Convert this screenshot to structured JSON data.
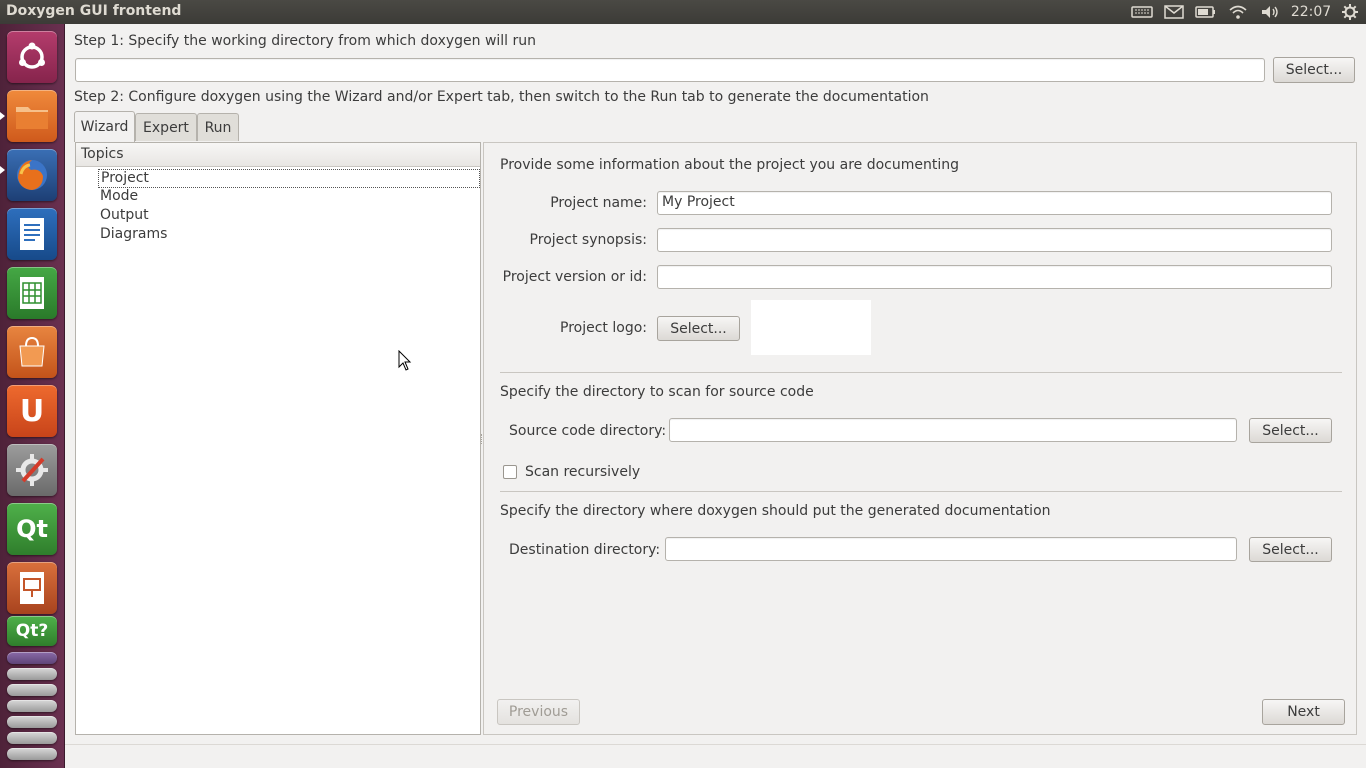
{
  "window": {
    "title": "Doxygen GUI frontend"
  },
  "indicators": {
    "clock": "22:07",
    "icons": [
      "keyboard-icon",
      "mail-icon",
      "battery-icon",
      "wifi-icon",
      "volume-icon",
      "gear-icon"
    ]
  },
  "launcher": {
    "items": [
      {
        "name": "ubuntu-dash-icon",
        "color": "#9c2f5c",
        "glyph": "◉"
      },
      {
        "name": "files-icon",
        "color": "#e8742e",
        "glyph": ""
      },
      {
        "name": "firefox-icon",
        "color": "#2d5ea0",
        "glyph": ""
      },
      {
        "name": "writer-icon",
        "color": "#1f5fa7",
        "glyph": ""
      },
      {
        "name": "calc-icon",
        "color": "#2f8f2f",
        "glyph": ""
      },
      {
        "name": "software-center-icon",
        "color": "#d9651f",
        "glyph": ""
      },
      {
        "name": "ubuntu-one-icon",
        "color": "#e35b22",
        "glyph": "U"
      },
      {
        "name": "settings-icon",
        "color": "#8a8a8a",
        "glyph": ""
      },
      {
        "name": "qtcreator-icon",
        "color": "#3e9b3a",
        "glyph": "Qt"
      },
      {
        "name": "impress-icon",
        "color": "#c4562a",
        "glyph": ""
      },
      {
        "name": "qt-assistant-icon",
        "color": "#3e9b3a",
        "glyph": "Qt?"
      }
    ]
  },
  "step1": {
    "label": "Step 1: Specify the working directory from which doxygen will run",
    "value": "",
    "button": "Select..."
  },
  "step2": {
    "label": "Step 2: Configure doxygen using the Wizard and/or Expert tab, then switch to the Run tab to generate the documentation"
  },
  "tabs": [
    {
      "label": "Wizard"
    },
    {
      "label": "Expert"
    },
    {
      "label": "Run"
    }
  ],
  "topics": {
    "header": "Topics",
    "items": [
      {
        "label": "Project"
      },
      {
        "label": "Mode"
      },
      {
        "label": "Output"
      },
      {
        "label": "Diagrams"
      }
    ]
  },
  "project": {
    "intro": "Provide some information about the project you are documenting",
    "name_label": "Project name:",
    "name_value": "My Project",
    "synopsis_label": "Project synopsis:",
    "synopsis_value": "",
    "version_label": "Project version or id:",
    "version_value": "",
    "logo_label": "Project logo:",
    "logo_button": "Select..."
  },
  "source": {
    "intro": "Specify the directory to scan for source code",
    "dir_label": "Source code directory:",
    "dir_value": "",
    "button": "Select...",
    "recursive_label": "Scan recursively",
    "recursive_checked": false
  },
  "destination": {
    "intro": "Specify the directory where doxygen should put the generated documentation",
    "dir_label": "Destination directory:",
    "dir_value": "",
    "button": "Select..."
  },
  "nav": {
    "previous": "Previous",
    "next": "Next"
  }
}
